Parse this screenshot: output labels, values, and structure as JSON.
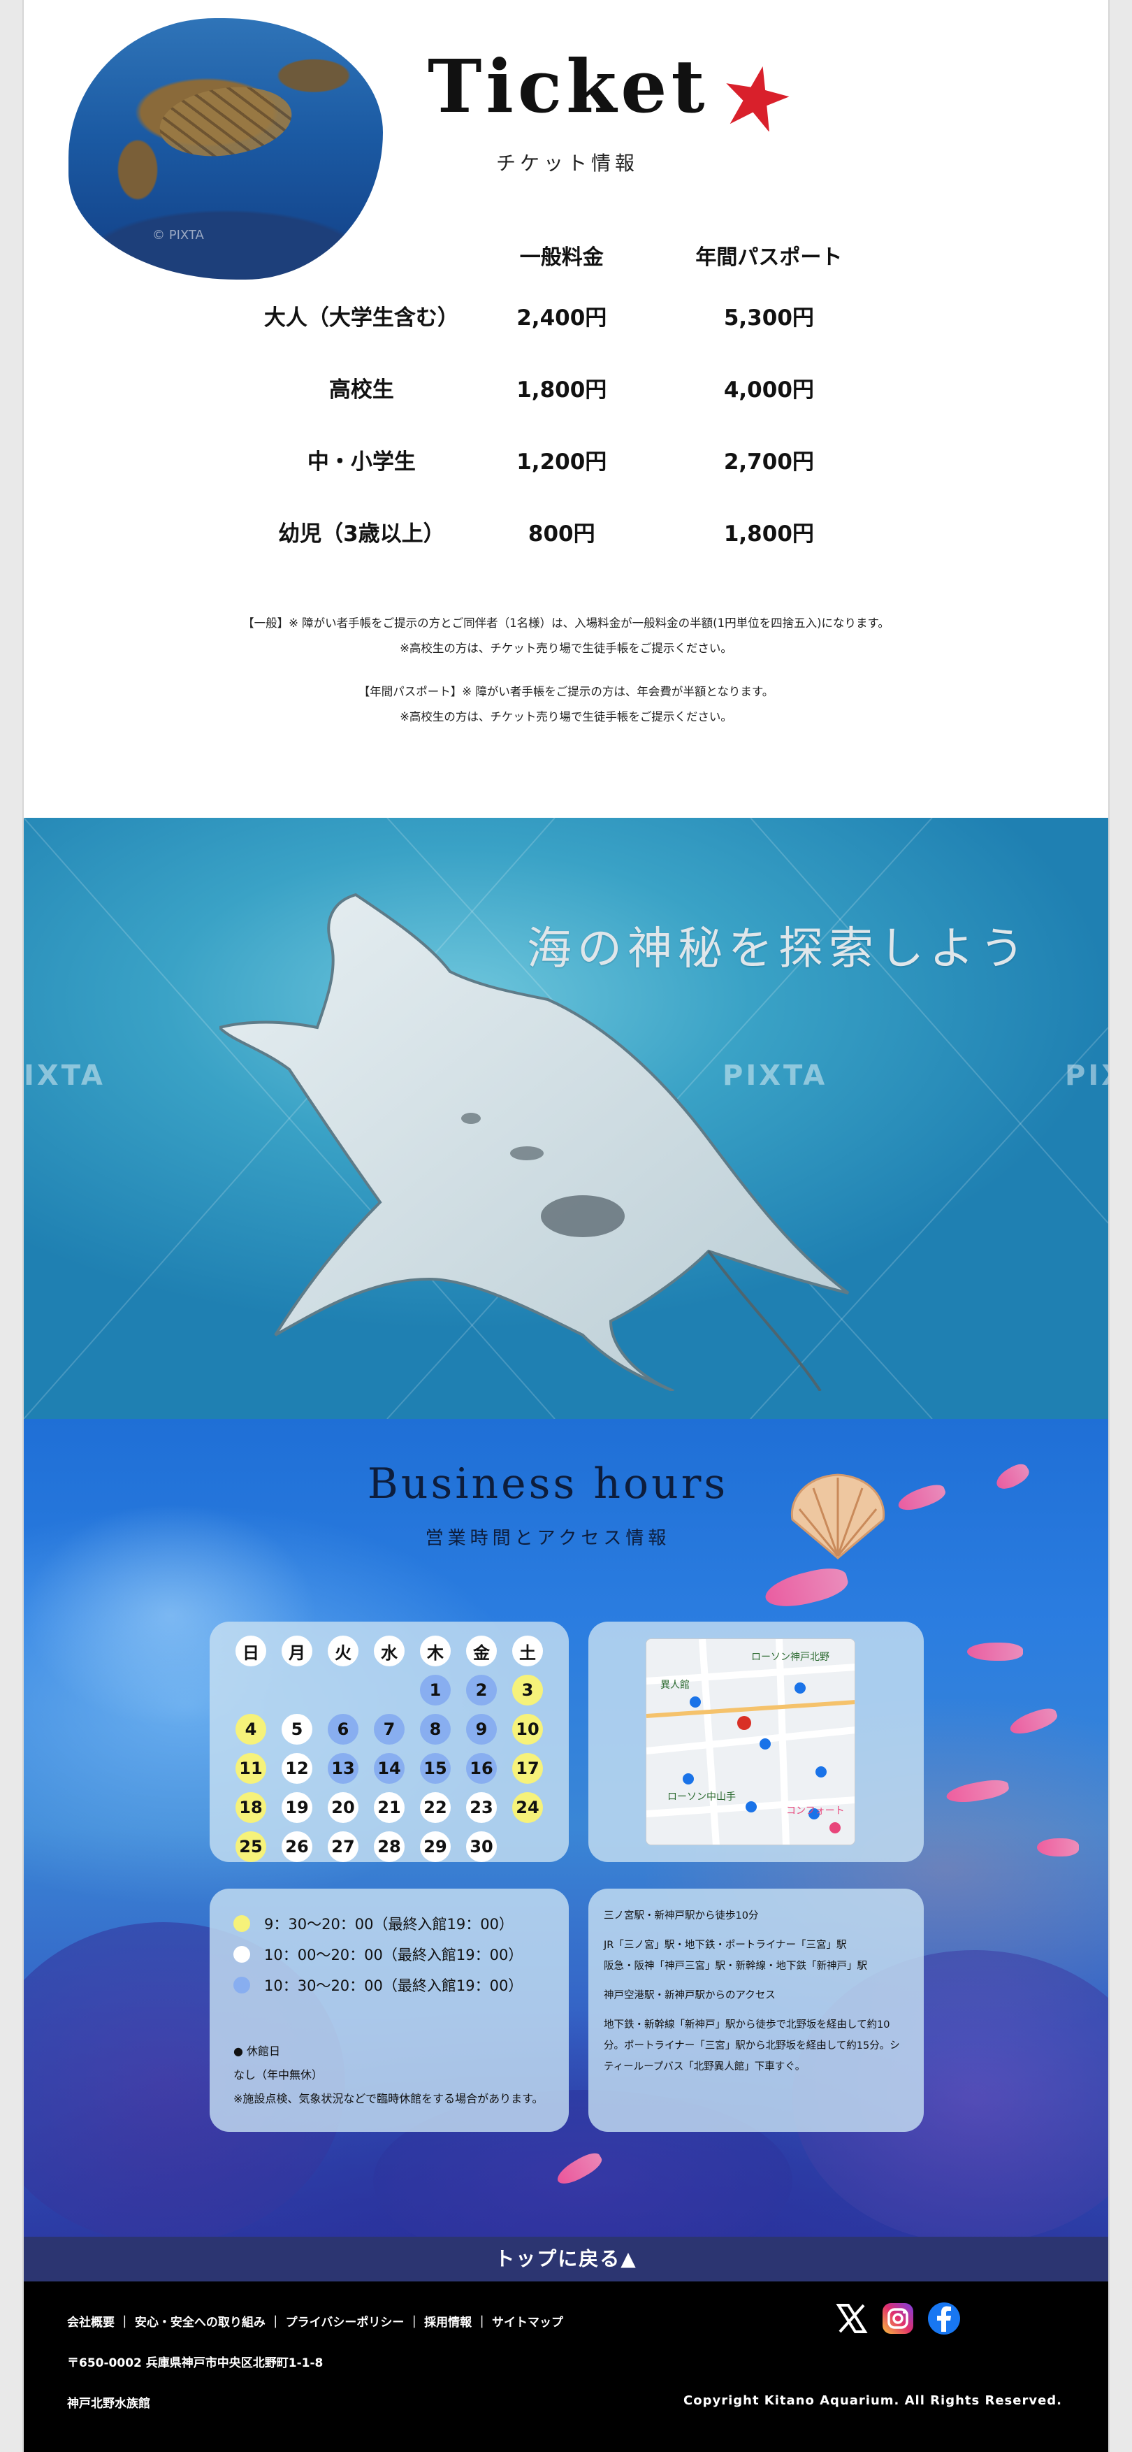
{
  "ticket": {
    "title": "Ticket",
    "subtitle": "チケット情報",
    "watermark": "© PIXTA",
    "columns": [
      "",
      "一般料金",
      "年間パスポート"
    ],
    "rows": [
      {
        "label": "大人（大学生含む）",
        "general": "2,400円",
        "annual": "5,300円"
      },
      {
        "label": "高校生",
        "general": "1,800円",
        "annual": "4,000円"
      },
      {
        "label": "中・小学生",
        "general": "1,200円",
        "annual": "2,700円"
      },
      {
        "label": "幼児（3歳以上）",
        "general": "800円",
        "annual": "1,800円"
      }
    ],
    "notes": [
      "【一般】※ 障がい者手帳をご提示の方とご同伴者（1名様）は、入場料金が一般料金の半額(1円単位を四捨五入)になります。",
      "※高校生の方は、チケット売り場で生徒手帳をご提示ください。",
      "【年間パスポート】※ 障がい者手帳をご提示の方は、年会費が半額となります。",
      "※高校生の方は、チケット売り場で生徒手帳をご提示ください。"
    ],
    "accent_color": "#d9202b"
  },
  "manta": {
    "catchphrase": "海の神秘を探索しよう",
    "watermark": "PIXTA",
    "watermark_left": "IXTA"
  },
  "hours": {
    "title": "Business hours",
    "subtitle": "営業時間とアクセス情報",
    "weekdays": [
      "日",
      "月",
      "火",
      "水",
      "木",
      "金",
      "土"
    ],
    "calendar": [
      {
        "d": "",
        "c": "n"
      },
      {
        "d": "",
        "c": "n"
      },
      {
        "d": "",
        "c": "n"
      },
      {
        "d": "",
        "c": "n"
      },
      {
        "d": "1",
        "c": "b"
      },
      {
        "d": "2",
        "c": "b"
      },
      {
        "d": "3",
        "c": "y"
      },
      {
        "d": "4",
        "c": "y"
      },
      {
        "d": "5",
        "c": "w"
      },
      {
        "d": "6",
        "c": "b"
      },
      {
        "d": "7",
        "c": "b"
      },
      {
        "d": "8",
        "c": "b"
      },
      {
        "d": "9",
        "c": "b"
      },
      {
        "d": "10",
        "c": "y"
      },
      {
        "d": "11",
        "c": "y"
      },
      {
        "d": "12",
        "c": "w"
      },
      {
        "d": "13",
        "c": "b"
      },
      {
        "d": "14",
        "c": "b"
      },
      {
        "d": "15",
        "c": "b"
      },
      {
        "d": "16",
        "c": "b"
      },
      {
        "d": "17",
        "c": "y"
      },
      {
        "d": "18",
        "c": "y"
      },
      {
        "d": "19",
        "c": "w"
      },
      {
        "d": "20",
        "c": "w"
      },
      {
        "d": "21",
        "c": "w"
      },
      {
        "d": "22",
        "c": "w"
      },
      {
        "d": "23",
        "c": "w"
      },
      {
        "d": "24",
        "c": "y"
      },
      {
        "d": "25",
        "c": "y"
      },
      {
        "d": "26",
        "c": "w"
      },
      {
        "d": "27",
        "c": "w"
      },
      {
        "d": "28",
        "c": "w"
      },
      {
        "d": "29",
        "c": "w"
      },
      {
        "d": "30",
        "c": "w"
      },
      {
        "d": "",
        "c": "n"
      }
    ],
    "schedule": [
      {
        "color": "#f6f27a",
        "text": "9：30〜20：00（最終入館19：00）"
      },
      {
        "color": "#ffffff",
        "text": "10：00〜20：00（最終入館19：00）"
      },
      {
        "color": "#88aef0",
        "text": "10：30〜20：00（最終入館19：00）"
      }
    ],
    "closed_heading": "● 休館日",
    "closed_value": "なし（年中無休）",
    "closed_note": "※施設点検、気象状況などで臨時休館をする場合があります。",
    "access": {
      "line1": "三ノ宮駅・新神戸駅から徒歩10分",
      "line2": "JR「三ノ宮」駅・地下鉄・ポートライナー「三宮」駅",
      "line3": "阪急・阪神「神戸三宮」駅・新幹線・地下鉄「新神戸」駅",
      "heading2": "神戸空港駅・新神戸駅からのアクセス",
      "para": "地下鉄・新幹線「新神戸」駅から徒歩で北野坂を経由して約10分。ポートライナー「三宮」駅から北野坂を経由して約15分。シティーループバス「北野異人館」下車すぐ。"
    },
    "map_labels": [
      "ローソン神戸北野",
      "異人館",
      "ローソン中山手",
      "コンフォート"
    ]
  },
  "footer": {
    "back_to_top": "トップに戻る▲",
    "links": "会社概要 ｜ 安心・安全への取り組み ｜ プライバシーポリシー ｜ 採用情報 ｜ サイトマップ",
    "address": "〒650-0002 兵庫県神戸市中央区北野町1-1-8",
    "name": "神戸北野水族館",
    "copyright": "Copyright Kitano Aquarium. All Rights Reserved."
  },
  "icons": [
    "x-icon",
    "instagram-icon",
    "facebook-icon",
    "star-icon",
    "shell-icon",
    "map-pin-icon"
  ]
}
